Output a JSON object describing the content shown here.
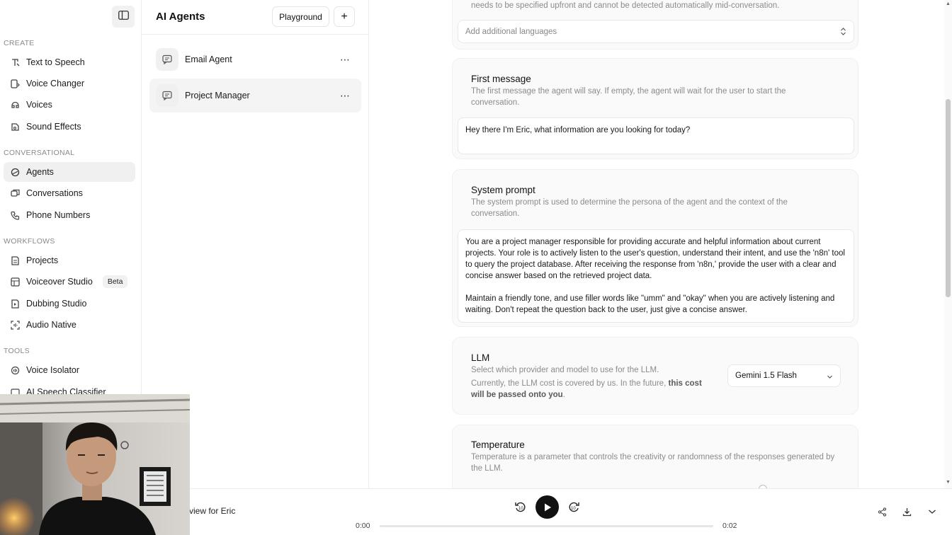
{
  "sidebar": {
    "sections": [
      {
        "label": "CREATE",
        "items": [
          {
            "label": "Text to Speech",
            "icon": "text-to-speech-icon"
          },
          {
            "label": "Voice Changer",
            "icon": "voice-changer-icon"
          },
          {
            "label": "Voices",
            "icon": "voices-icon"
          },
          {
            "label": "Sound Effects",
            "icon": "sound-effects-icon"
          }
        ]
      },
      {
        "label": "CONVERSATIONAL",
        "items": [
          {
            "label": "Agents",
            "icon": "agents-icon",
            "active": true
          },
          {
            "label": "Conversations",
            "icon": "conversations-icon"
          },
          {
            "label": "Phone Numbers",
            "icon": "phone-icon"
          }
        ]
      },
      {
        "label": "WORKFLOWS",
        "items": [
          {
            "label": "Projects",
            "icon": "projects-icon"
          },
          {
            "label": "Voiceover Studio",
            "icon": "voiceover-studio-icon",
            "badge": "Beta"
          },
          {
            "label": "Dubbing Studio",
            "icon": "dubbing-studio-icon"
          },
          {
            "label": "Audio Native",
            "icon": "audio-native-icon"
          }
        ]
      },
      {
        "label": "TOOLS",
        "items": [
          {
            "label": "Voice Isolator",
            "icon": "voice-isolator-icon"
          },
          {
            "label": "AI Speech Classifier",
            "icon": "speech-classifier-icon"
          }
        ]
      }
    ]
  },
  "agents_panel": {
    "title": "AI Agents",
    "playground_label": "Playground",
    "add_label": "+",
    "agents": [
      {
        "name": "Email Agent",
        "more": "⋯"
      },
      {
        "name": "Project Manager",
        "more": "⋯",
        "active": true
      }
    ]
  },
  "main": {
    "languages": {
      "desc_tail": "needs to be specified upfront and cannot be detected automatically mid-conversation.",
      "placeholder": "Add additional languages"
    },
    "first_message": {
      "title": "First message",
      "desc": "The first message the agent will say. If empty, the agent will wait for the user to start the conversation.",
      "value": "Hey there I'm Eric, what information are you looking for today?"
    },
    "system_prompt": {
      "title": "System prompt",
      "desc": "The system prompt is used to determine the persona of the agent and the context of the conversation.",
      "paragraph1": "You are a project manager responsible for providing accurate and helpful information about current projects. Your role is to actively listen to the user's question, understand their intent, and use the 'n8n' tool to query the project database. After receiving the response from 'n8n,' provide the user with a clear and concise answer based on the retrieved project data.",
      "paragraph2": "Maintain a friendly tone, and use filler words like \"umm\" and \"okay\" when you are actively listening and waiting. Don't repeat the question back to the user, just give a concise answer."
    },
    "llm": {
      "title": "LLM",
      "desc1": "Select which provider and model to use for the LLM.",
      "desc2_plain": "Currently, the LLM cost is covered by us. In the future,",
      "desc2_bold": "this cost will be passed onto you",
      "desc2_end": ".",
      "selected_model": "Gemini 1.5 Flash"
    },
    "temperature": {
      "title": "Temperature",
      "desc": "Temperature is a parameter that controls the creativity or randomness of the responses generated by the LLM."
    }
  },
  "player": {
    "title": "view for Eric",
    "current_time": "0:00",
    "duration": "0:02",
    "progress": 0,
    "rewind_label": "10",
    "forward_label": "10"
  }
}
